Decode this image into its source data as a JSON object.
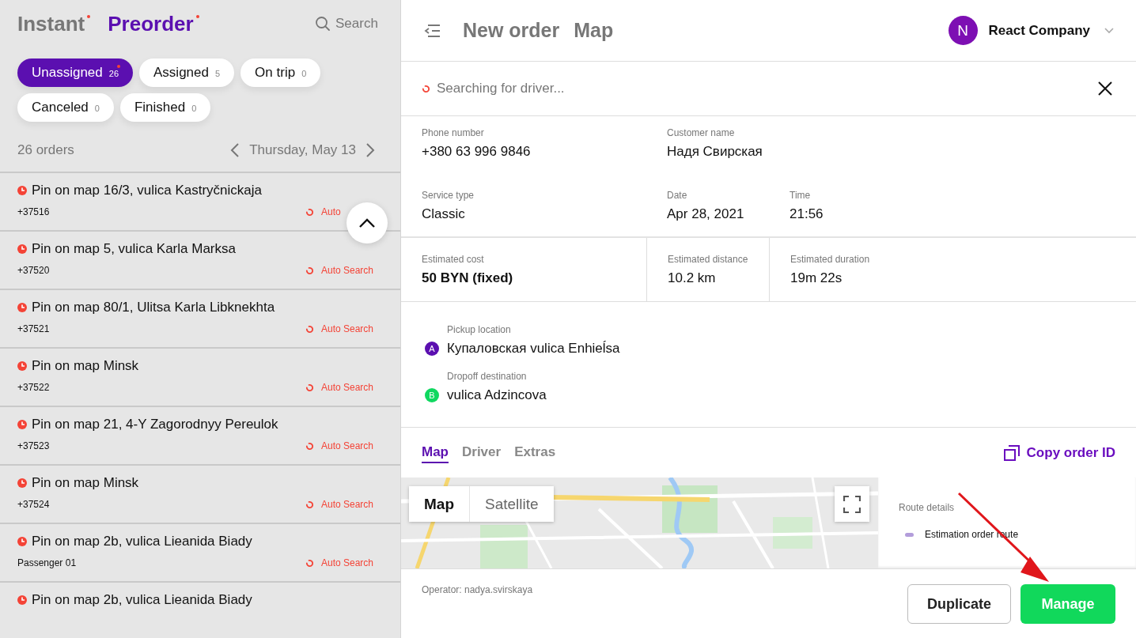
{
  "sidebar": {
    "modes": [
      {
        "label": "Instant",
        "selected": false,
        "dot": true
      },
      {
        "label": "Preorder",
        "selected": true,
        "dot": true
      }
    ],
    "search": {
      "placeholder": "Search"
    },
    "filters": [
      {
        "label": "Unassigned",
        "count": "26",
        "selected": true,
        "dot": true
      },
      {
        "label": "Assigned",
        "count": "5",
        "selected": false,
        "dot": false
      },
      {
        "label": "On trip",
        "count": "0",
        "selected": false,
        "dot": false
      },
      {
        "label": "Canceled",
        "count": "0",
        "selected": false,
        "dot": false
      },
      {
        "label": "Finished",
        "count": "0",
        "selected": false,
        "dot": false
      }
    ],
    "order_count": "26 orders",
    "date": "Thursday, May 13",
    "orders": [
      {
        "title": "Pin on map 16/3, vulica Kastryčnickaja",
        "subtitle": "+37516",
        "status": "Auto"
      },
      {
        "title": "Pin on map 5, vulica Karla Marksa",
        "subtitle": "+37520",
        "status": "Auto Search"
      },
      {
        "title": "Pin on map 80/1, Ulitsa Karla Libknekhta",
        "subtitle": "+37521",
        "status": "Auto Search"
      },
      {
        "title": "Pin on map Minsk",
        "subtitle": "+37522",
        "status": "Auto Search"
      },
      {
        "title": "Pin on map 21, 4-Y Zagorodnyy Pereulok",
        "subtitle": "+37523",
        "status": "Auto Search"
      },
      {
        "title": "Pin on map Minsk",
        "subtitle": "+37524",
        "status": "Auto Search"
      },
      {
        "title": "Pin on map 2b, vulica Lieanida Biady",
        "subtitle": "Passenger 01",
        "status": "Auto Search"
      },
      {
        "title": "Pin on map 2b, vulica Lieanida Biady"
      }
    ]
  },
  "header": {
    "breadcrumbs": [
      "New order",
      "Map"
    ],
    "account": {
      "initial": "N",
      "name": "React Company"
    }
  },
  "order": {
    "status": "Searching for driver...",
    "details": [
      [
        {
          "label": "Phone number",
          "value": "+380 63 996 9846"
        },
        {
          "label": "Customer name",
          "value": "Надя Свирская"
        }
      ],
      [
        {
          "label": "Service type",
          "value": "Classic"
        },
        {
          "label": "Date",
          "value": "Apr 28, 2021"
        },
        {
          "label": "Time",
          "value": "21:56"
        }
      ]
    ],
    "estimates": [
      {
        "label": "Estimated cost",
        "value": "50 BYN (fixed)",
        "emphasis": true
      },
      {
        "label": "Estimated distance",
        "value": "10.2 km",
        "emphasis": false
      },
      {
        "label": "Estimated duration",
        "value": "19m 22s",
        "emphasis": false
      }
    ],
    "locations": [
      {
        "label": "Pickup location",
        "address": "Купаловская vulica Enhieĺsa",
        "marker": "A",
        "color": "#5b0fb0"
      },
      {
        "label": "Dropoff destination",
        "address": "vulica Adzincova",
        "marker": "B",
        "color": "#10d860"
      }
    ],
    "tabs": [
      {
        "label": "Map",
        "selected": true
      },
      {
        "label": "Driver",
        "selected": false
      },
      {
        "label": "Extras",
        "selected": false
      }
    ],
    "copy_action": "Copy order ID",
    "map": {
      "kind": "picture",
      "map_types": [
        {
          "label": "Map",
          "selected": true
        },
        {
          "label": "Satellite",
          "selected": false
        }
      ]
    },
    "route": {
      "title": "Route details",
      "items": [
        {
          "label": "Estimation order route",
          "color": "#b39ddb"
        }
      ]
    },
    "operator": "Operator: nadya.svirskaya",
    "buttons": [
      {
        "label": "Duplicate",
        "kind": "secondary"
      },
      {
        "label": "Manage",
        "kind": "primary"
      }
    ]
  }
}
